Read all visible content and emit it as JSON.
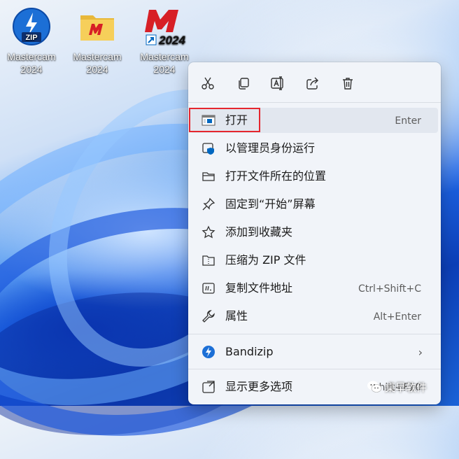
{
  "desktop": {
    "icons": [
      {
        "name": "Mastercam",
        "version": "2024",
        "badge": "ZIP"
      },
      {
        "name": "Mastercam",
        "version": "2024",
        "badge": ""
      },
      {
        "name": "Mastercam",
        "version": "2024",
        "badge": "2024"
      }
    ]
  },
  "context_menu": {
    "toolbar": [
      {
        "icon": "cut-icon"
      },
      {
        "icon": "copy-icon"
      },
      {
        "icon": "rename-icon"
      },
      {
        "icon": "share-icon"
      },
      {
        "icon": "delete-icon"
      }
    ],
    "items": [
      {
        "label": "打开",
        "shortcut": "Enter",
        "icon": "open-icon"
      },
      {
        "label": "以管理员身份运行",
        "shortcut": "",
        "icon": "shield-icon"
      },
      {
        "label": "打开文件所在的位置",
        "shortcut": "",
        "icon": "folder-icon"
      },
      {
        "label": "固定到“开始”屏幕",
        "shortcut": "",
        "icon": "pin-icon"
      },
      {
        "label": "添加到收藏夹",
        "shortcut": "",
        "icon": "star-icon"
      },
      {
        "label": "压缩为 ZIP 文件",
        "shortcut": "",
        "icon": "zip-icon"
      },
      {
        "label": "复制文件地址",
        "shortcut": "Ctrl+Shift+C",
        "icon": "copy-path-icon"
      },
      {
        "label": "属性",
        "shortcut": "Alt+Enter",
        "icon": "wrench-icon"
      },
      {
        "label": "Bandizip",
        "shortcut": "",
        "icon": "bandizip-icon"
      },
      {
        "label": "显示更多选项",
        "shortcut": "Shift+F10",
        "icon": "more-options-icon"
      }
    ]
  },
  "watermark": {
    "text": "桌早软件"
  },
  "colors": {
    "accent": "#0067c0",
    "highlight_box": "#e5262e",
    "brand_red": "#d71f26"
  }
}
